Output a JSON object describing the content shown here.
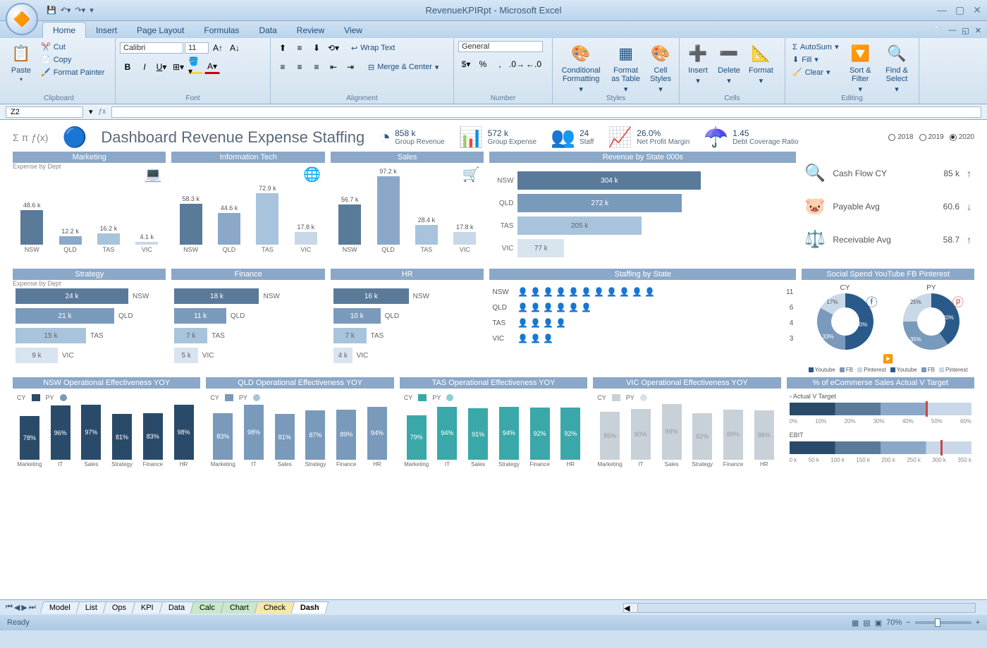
{
  "window": {
    "title": "RevenueKPIRpt - Microsoft Excel"
  },
  "tabs": {
    "home": "Home",
    "insert": "Insert",
    "pagelayout": "Page Layout",
    "formulas": "Formulas",
    "data": "Data",
    "review": "Review",
    "view": "View"
  },
  "ribbon": {
    "clipboard": {
      "label": "Clipboard",
      "paste": "Paste",
      "cut": "Cut",
      "copy": "Copy",
      "painter": "Format Painter"
    },
    "font": {
      "label": "Font",
      "name": "Calibri",
      "size": "11"
    },
    "alignment": {
      "label": "Alignment",
      "wrap": "Wrap Text",
      "merge": "Merge & Center"
    },
    "number": {
      "label": "Number",
      "format": "General"
    },
    "styles": {
      "label": "Styles",
      "cond": "Conditional Formatting",
      "table": "Format as Table",
      "cell": "Cell Styles"
    },
    "cells": {
      "label": "Cells",
      "insert": "Insert",
      "delete": "Delete",
      "format": "Format"
    },
    "editing": {
      "label": "Editing",
      "autosum": "AutoSum",
      "fill": "Fill",
      "clear": "Clear",
      "sort": "Sort & Filter",
      "find": "Find & Select"
    }
  },
  "formula": {
    "cell": "Z2"
  },
  "dashboard": {
    "title": "Dashboard Revenue Expense Staffing",
    "expense_label": "Expense by Dept",
    "kpis": {
      "revenue": {
        "value": "858 k",
        "label": "Group Revenue"
      },
      "expense": {
        "value": "572 k",
        "label": "Group Expense"
      },
      "staff": {
        "value": "24",
        "label": "Staff"
      },
      "margin": {
        "value": "26.0%",
        "label": "Net Profit Margin"
      },
      "debt": {
        "value": "1.45",
        "label": "Debt Coverage Ratio"
      }
    },
    "years": {
      "y1": "2018",
      "y2": "2019",
      "y3": "2020"
    },
    "headers": {
      "marketing": "Marketing",
      "it": "Information Tech",
      "sales": "Sales",
      "revstate": "Revenue by State 000s",
      "strategy": "Strategy",
      "finance": "Finance",
      "hr": "HR",
      "staffstate": "Staffing by State",
      "social": "Social Spend YouTube FB Pinterest",
      "opnsw": "NSW Operational Effectiveness YOY",
      "opqld": "QLD Operational Effectiveness YOY",
      "optas": "TAS Operational Effectiveness YOY",
      "opvic": "VIC Operational Effectiveness YOY",
      "ecomm": "% of eCommerse Sales Actual V Target"
    },
    "metrics": {
      "cashflow": {
        "label": "Cash Flow CY",
        "value": "85 k"
      },
      "payable": {
        "label": "Payable Avg",
        "value": "60.6"
      },
      "receivable": {
        "label": "Receivable Avg",
        "value": "58.7"
      }
    },
    "social": {
      "cy": "CY",
      "py": "PY",
      "legend": {
        "yt": "Youtube",
        "fb": "FB",
        "pin": "Pinterest"
      }
    },
    "oplegend": {
      "cy": "CY",
      "py": "PY"
    },
    "bullet": {
      "actual": "Actual V Target",
      "ebit": "EBIT"
    }
  },
  "chart_data": {
    "expense_by_dept_top": {
      "type": "bar",
      "states": [
        "NSW",
        "QLD",
        "TAS",
        "VIC"
      ],
      "marketing": [
        48.6,
        12.2,
        16.2,
        4.1
      ],
      "it": [
        58.3,
        44.6,
        72.9,
        17.8
      ],
      "sales": [
        56.7,
        97.2,
        28.4,
        17.8
      ]
    },
    "expense_by_dept_bottom": {
      "type": "bar",
      "states": [
        "NSW",
        "QLD",
        "TAS",
        "VIC"
      ],
      "strategy": [
        24,
        21,
        15,
        9
      ],
      "finance": [
        18,
        11,
        7,
        5
      ],
      "hr": [
        16,
        10,
        7,
        4
      ]
    },
    "revenue_by_state": {
      "type": "bar",
      "categories": [
        "NSW",
        "QLD",
        "TAS",
        "VIC"
      ],
      "values": [
        304,
        272,
        205,
        77
      ]
    },
    "staffing_by_state": {
      "categories": [
        "NSW",
        "QLD",
        "TAS",
        "VIC"
      ],
      "values": [
        11,
        6,
        4,
        3
      ]
    },
    "social_spend": {
      "cy": {
        "youtube": 50,
        "fb": 33,
        "pinterest": 17
      },
      "py": {
        "youtube": 40,
        "fb": 35,
        "pinterest": 25
      }
    },
    "operational_effectiveness": {
      "categories": [
        "Marketing",
        "IT",
        "Sales",
        "Strategy",
        "Finance",
        "HR"
      ],
      "nsw": [
        78,
        96,
        97,
        81,
        83,
        98
      ],
      "qld": [
        83,
        98,
        81,
        87,
        89,
        94
      ],
      "tas": [
        79,
        94,
        91,
        94,
        92,
        92
      ],
      "vic": [
        85,
        90,
        99,
        82,
        89,
        88
      ]
    },
    "ecommerce": {
      "actual_v_target": 45,
      "ebit": 290,
      "ebit_axis": [
        0,
        50,
        100,
        150,
        200,
        250,
        300,
        350
      ],
      "pct_axis": [
        0,
        10,
        20,
        30,
        40,
        50,
        60
      ]
    }
  },
  "sheets": {
    "model": "Model",
    "list": "List",
    "ops": "Ops",
    "kpi": "KPI",
    "data": "Data",
    "calc": "Calc",
    "chart": "Chart",
    "check": "Check",
    "dash": "Dash"
  },
  "status": {
    "ready": "Ready",
    "zoom": "70%"
  }
}
